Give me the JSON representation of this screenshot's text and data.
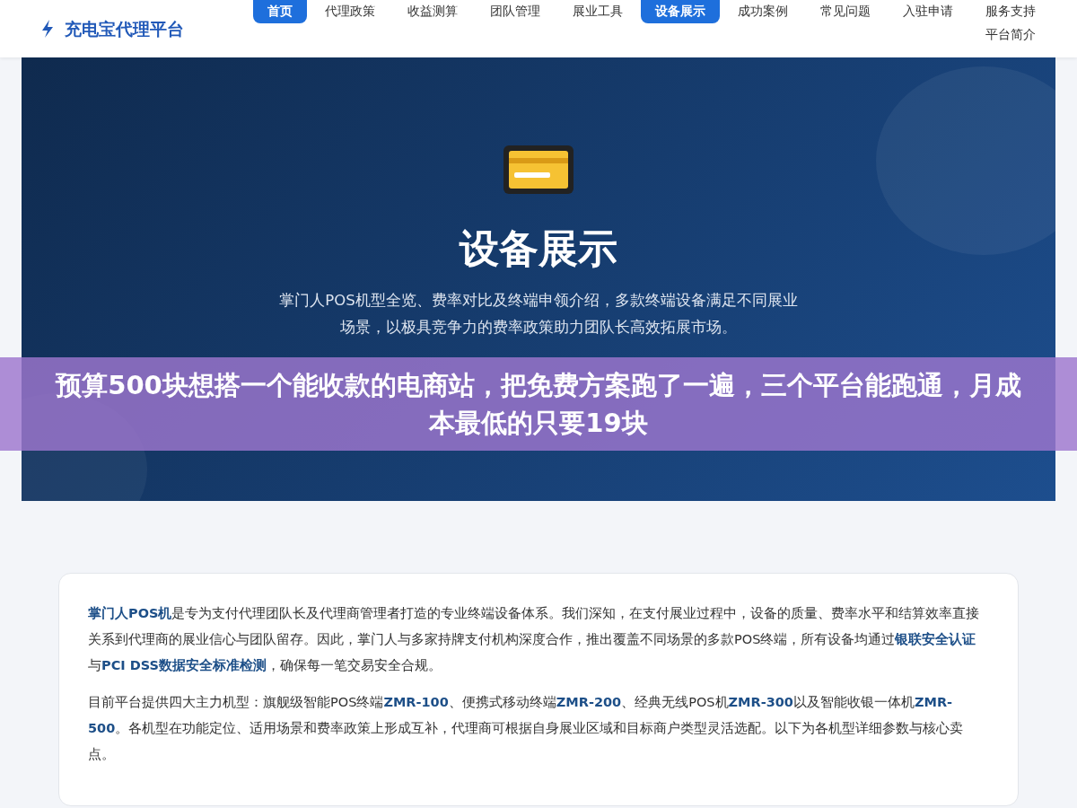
{
  "logo": {
    "text": "充电宝代理平台"
  },
  "nav": [
    {
      "label": "首页",
      "selected": true
    },
    {
      "label": "代理政策",
      "selected": false
    },
    {
      "label": "收益测算",
      "selected": false
    },
    {
      "label": "团队管理",
      "selected": false
    },
    {
      "label": "展业工具",
      "selected": false
    },
    {
      "label": "设备展示",
      "selected": true
    },
    {
      "label": "成功案例",
      "selected": false
    },
    {
      "label": "常见问题",
      "selected": false
    },
    {
      "label": "入驻申请",
      "selected": false
    },
    {
      "label": "服务支持",
      "selected": false
    },
    {
      "label": "平台简介",
      "selected": false
    }
  ],
  "hero": {
    "title": "设备展示",
    "subtitle": "掌门人POS机型全览、费率对比及终端申领介绍，多款终端设备满足不同展业场景，以极具竞争力的费率政策助力团队长高效拓展市场。"
  },
  "banner": {
    "text": "预算500块想搭一个能收款的电商站，把免费方案跑了一遍，三个平台能跑通，月成本最低的只要19块"
  },
  "intro": [
    "**掌门人POS机**是专为支付代理团队长及代理商管理者打造的专业终端设备体系。我们深知，在支付展业过程中，设备的质量、费率水平和结算效率直接关系到代理商的展业信心与团队留存。因此，掌门人与多家持牌支付机构深度合作，推出覆盖不同场景的多款POS终端，所有设备均通过**银联安全认证**与**PCI DSS数据安全标准检测**，确保每一笔交易安全合规。",
    "目前平台提供四大主力机型：旗舰级智能POS终端**ZMR-100**、便携式移动终端**ZMR-200**、经典无线POS机**ZMR-300**以及智能收银一体机**ZMR-500**。各机型在功能定位、适用场景和费率政策上形成互补，代理商可根据自身展业区域和目标商户类型灵活选配。以下为各机型详细参数与核心卖点。"
  ]
}
